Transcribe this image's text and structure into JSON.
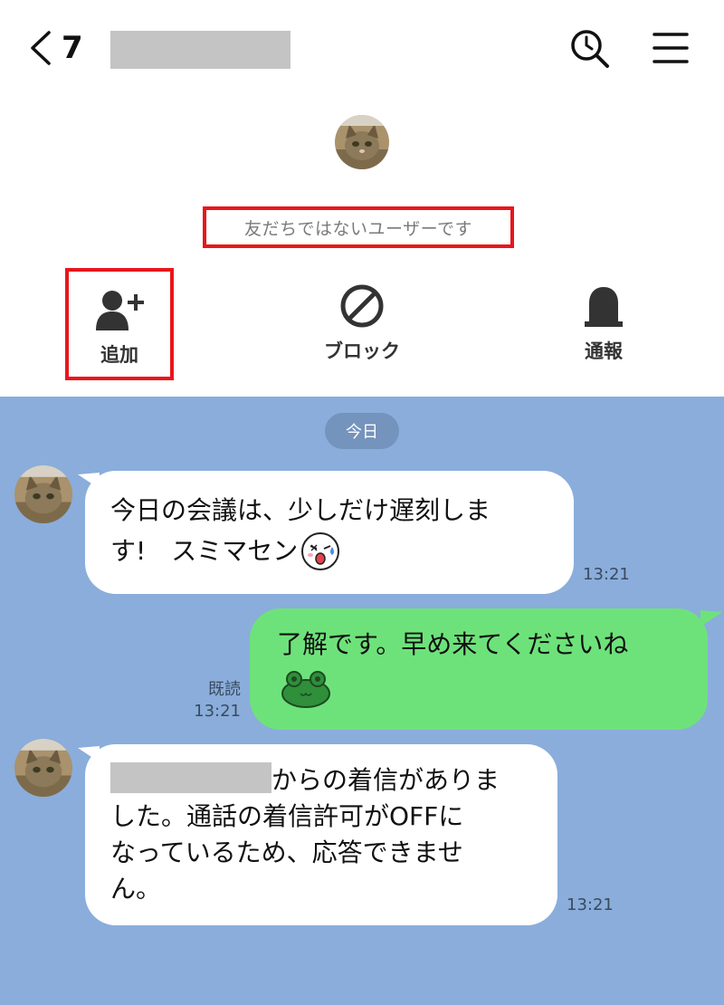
{
  "header": {
    "back_count": "7",
    "contact_name_redacted": true
  },
  "profile": {
    "notice": "友だちではないユーザーです",
    "actions": [
      {
        "label": "追加",
        "icon": "add-friend-icon"
      },
      {
        "label": "ブロック",
        "icon": "block-icon"
      },
      {
        "label": "通報",
        "icon": "report-icon"
      }
    ]
  },
  "chat": {
    "date_label": "今日",
    "messages": [
      {
        "direction": "incoming",
        "lines": [
          "今日の会議は、少しだけ遅刻しま",
          "す!　スミマセン"
        ],
        "sticker": "sweating-face-emoji",
        "time": "13:21"
      },
      {
        "direction": "outgoing",
        "text": "了解です。早め来てくださいね",
        "sticker": "frog-emoji",
        "read_label": "既読",
        "time": "13:21"
      },
      {
        "direction": "incoming",
        "line1_suffix": "からの着信がありま",
        "lines": [
          "した。通話の着信許可がOFFに",
          "なっているため、応答できませ",
          "ん。"
        ],
        "time": "13:21"
      }
    ]
  },
  "colors": {
    "chat_background": "#8aaddb",
    "outgoing_bubble": "#6ee27a",
    "incoming_bubble": "#ffffff",
    "highlight_box": "#e8161c"
  }
}
